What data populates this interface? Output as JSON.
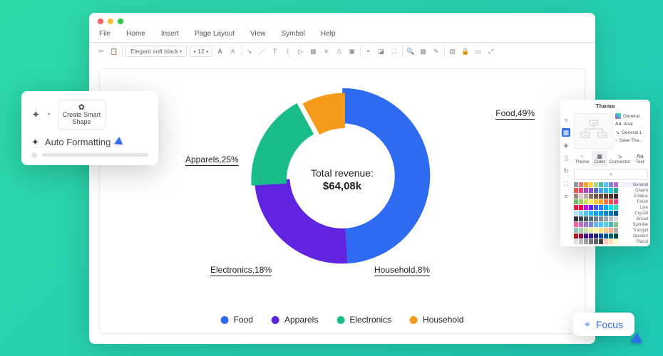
{
  "chart_data": {
    "type": "pie",
    "title": "Total revenue:",
    "center_value": "$64,08k",
    "series": [
      {
        "name": "Food",
        "value": 49,
        "color": "#2e6bf0"
      },
      {
        "name": "Apparels",
        "value": 25,
        "color": "#6024e0"
      },
      {
        "name": "Electronics",
        "value": 18,
        "color": "#1abc8a"
      },
      {
        "name": "Household",
        "value": 8,
        "color": "#f59a1b"
      }
    ],
    "labels": [
      "Food,49%",
      "Apparels,25%",
      "Electronics,18%",
      "Household,8%"
    ]
  },
  "menus": [
    "File",
    "Home",
    "Insert",
    "Page Layout",
    "View",
    "Symbol",
    "Help"
  ],
  "toolbar": {
    "font": "Elegant soft black",
    "size": "12"
  },
  "popup": {
    "create_smart_shape": "Create Smart\nShape",
    "auto_formatting": "Auto Formatting"
  },
  "theme_panel": {
    "title": "Theme",
    "options": [
      "General",
      "Arial",
      "General 1",
      "Save The..."
    ],
    "tabs": [
      "Theme",
      "Color",
      "Connector",
      "Text"
    ],
    "palettes": [
      "General",
      "Charm",
      "Antique",
      "Fresh",
      "Live",
      "Crystal",
      "Broad",
      "Sprinkle",
      "Tranquil",
      "Opulent",
      "Placid"
    ]
  },
  "focus": {
    "label": "Focus"
  }
}
